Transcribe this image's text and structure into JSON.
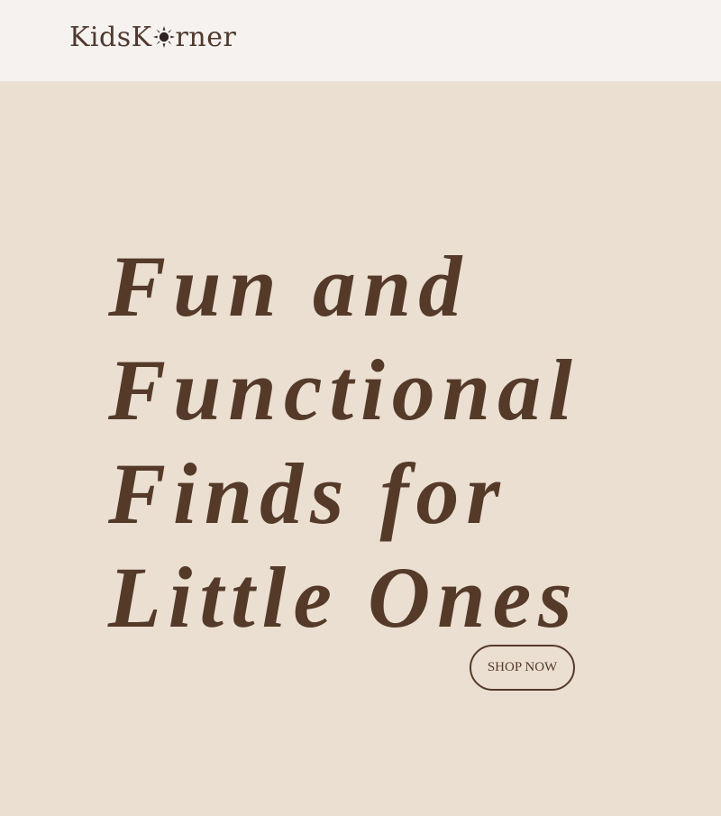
{
  "header": {
    "logo_prefix": "KidsK",
    "logo_suffix": "rner",
    "logo_icon": "sun-icon"
  },
  "hero": {
    "headline_lines": [
      "Fun and",
      "Functional",
      "Finds for",
      "Little Ones"
    ],
    "cta_label": "SHOP NOW"
  },
  "colors": {
    "header_bg": "#f5f2f0",
    "hero_bg": "#eadfd1",
    "text_brown": "#553a29",
    "logo_brown": "#50382d"
  }
}
